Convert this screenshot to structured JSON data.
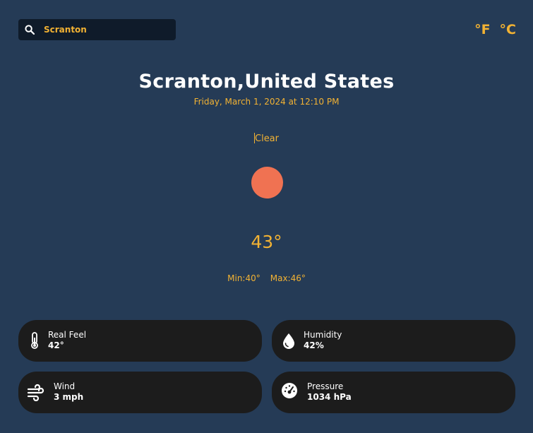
{
  "search": {
    "value": "Scranton",
    "icon": "search-icon"
  },
  "units": {
    "fahrenheit": "°F",
    "celsius": "°C"
  },
  "location": {
    "title": "Scranton,United States",
    "datetime": "Friday, March 1, 2024 at 12:10 PM"
  },
  "weather": {
    "condition": "Clear",
    "icon": "sun-icon",
    "icon_color": "#f07252",
    "temperature": "43°",
    "min": "Min:40°",
    "max": "Max:46°"
  },
  "details": [
    {
      "label": "Real Feel",
      "value": "42°",
      "icon": "thermometer-icon"
    },
    {
      "label": "Humidity",
      "value": "42%",
      "icon": "water-drop-icon"
    },
    {
      "label": "Wind",
      "value": "3 mph",
      "icon": "wind-icon"
    },
    {
      "label": "Pressure",
      "value": "1034 hPa",
      "icon": "gauge-icon"
    }
  ],
  "colors": {
    "background": "#253b56",
    "accent": "#f2b233",
    "card": "#1c1c1c",
    "search_bg": "#0f1b2a"
  }
}
